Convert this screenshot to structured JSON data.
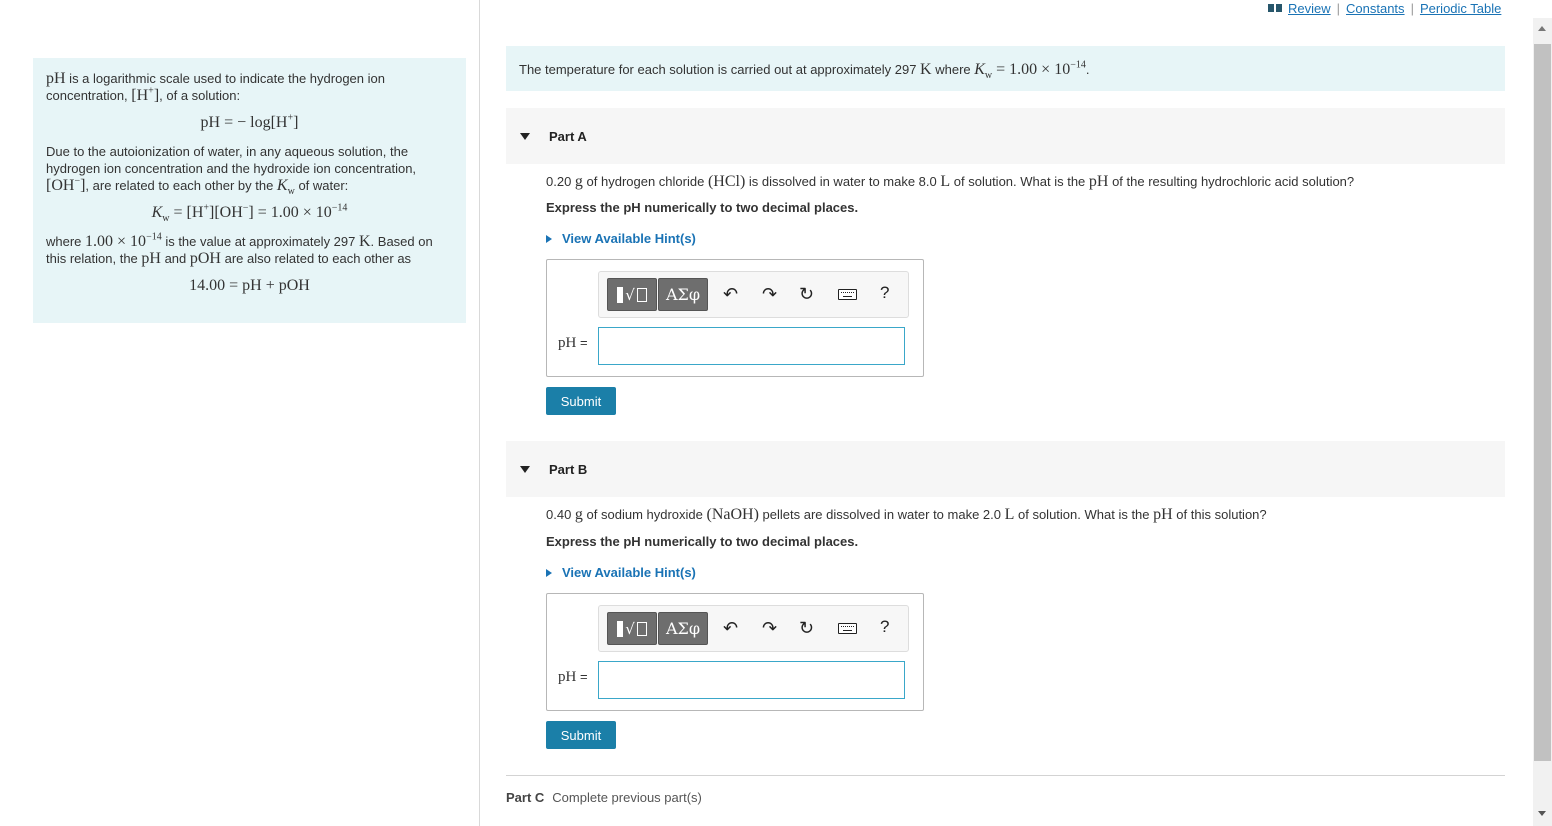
{
  "top_links": {
    "review": "Review",
    "constants": "Constants",
    "periodic_table": "Periodic Table",
    "separator": "|"
  },
  "intro": {
    "p1_a": "pH",
    "p1_b": " is a logarithmic scale used to indicate the hydrogen ion concentration, ",
    "p1_c": "[H",
    "p1_c_sup": "+",
    "p1_d": "]",
    "p1_e": ", of a solution:",
    "eq1": "pH = − log[H",
    "eq1_sup": "+",
    "eq1_end": "]",
    "p2_a": "Due to the autoionization of water, in any aqueous solution, the hydrogen ion concentration and the hydroxide ion concentration, ",
    "p2_b": "[OH",
    "p2_b_sup": "−",
    "p2_c": "]",
    "p2_d": ", are related to each other by the ",
    "p2_kw": "K",
    "p2_kw_sub": "w",
    "p2_e": " of water:",
    "eq2_kw": "K",
    "eq2_kw_sub": "w",
    "eq2_rest": " = [H",
    "eq2_sup1": "+",
    "eq2_mid": "][OH",
    "eq2_sup2": "−",
    "eq2_end": "] = 1.00 × 10",
    "eq2_exp": "−14",
    "p3_a": "where ",
    "p3_val": "1.00 × 10",
    "p3_exp": "−14",
    "p3_b": " is the value at approximately 297 ",
    "p3_k": "K",
    "p3_c": ". Based on this relation, the ",
    "p3_ph": "pH",
    "p3_d": " and ",
    "p3_poh": "pOH",
    "p3_e": " are also related to each other as",
    "eq3": "14.00 = pH + pOH"
  },
  "banner": {
    "text_a": "The temperature for each solution is carried out at approximately 297 ",
    "k": "K",
    "text_b": " where ",
    "kw": "K",
    "kw_sub": "w",
    "val": " = 1.00 × 10",
    "exp": "−14",
    "end": "."
  },
  "part_a": {
    "title": "Part A",
    "q_a": "0.20 ",
    "q_g": "g",
    "q_b": " of hydrogen chloride ",
    "q_formula": "(HCl)",
    "q_c": " is dissolved in water to make 8.0 ",
    "q_l": "L",
    "q_d": "  of solution. What is the ",
    "q_ph": "pH",
    "q_e": " of the resulting hydrochloric acid solution?",
    "instruction": "Express the pH numerically to two decimal places.",
    "hint": "View Available Hint(s)",
    "greek": "ΑΣφ",
    "help": "?",
    "ph_label": "pH",
    "ph_eq": " =",
    "answer": "",
    "submit": "Submit"
  },
  "part_b": {
    "title": "Part B",
    "q_a": "0.40 ",
    "q_g": "g",
    "q_b": " of sodium hydroxide ",
    "q_formula": "(NaOH)",
    "q_c": " pellets are dissolved in water to make 2.0 ",
    "q_l": "L",
    "q_d": " of solution. What is the ",
    "q_ph": "pH",
    "q_e": " of this solution?",
    "instruction": "Express the pH numerically to two decimal places.",
    "hint": "View Available Hint(s)",
    "greek": "ΑΣφ",
    "help": "?",
    "ph_label": "pH",
    "ph_eq": " =",
    "answer": "",
    "submit": "Submit"
  },
  "part_c": {
    "title": "Part C",
    "status": "Complete previous part(s)"
  },
  "icons": {
    "undo": "↶",
    "redo": "↷",
    "reset": "↻"
  }
}
